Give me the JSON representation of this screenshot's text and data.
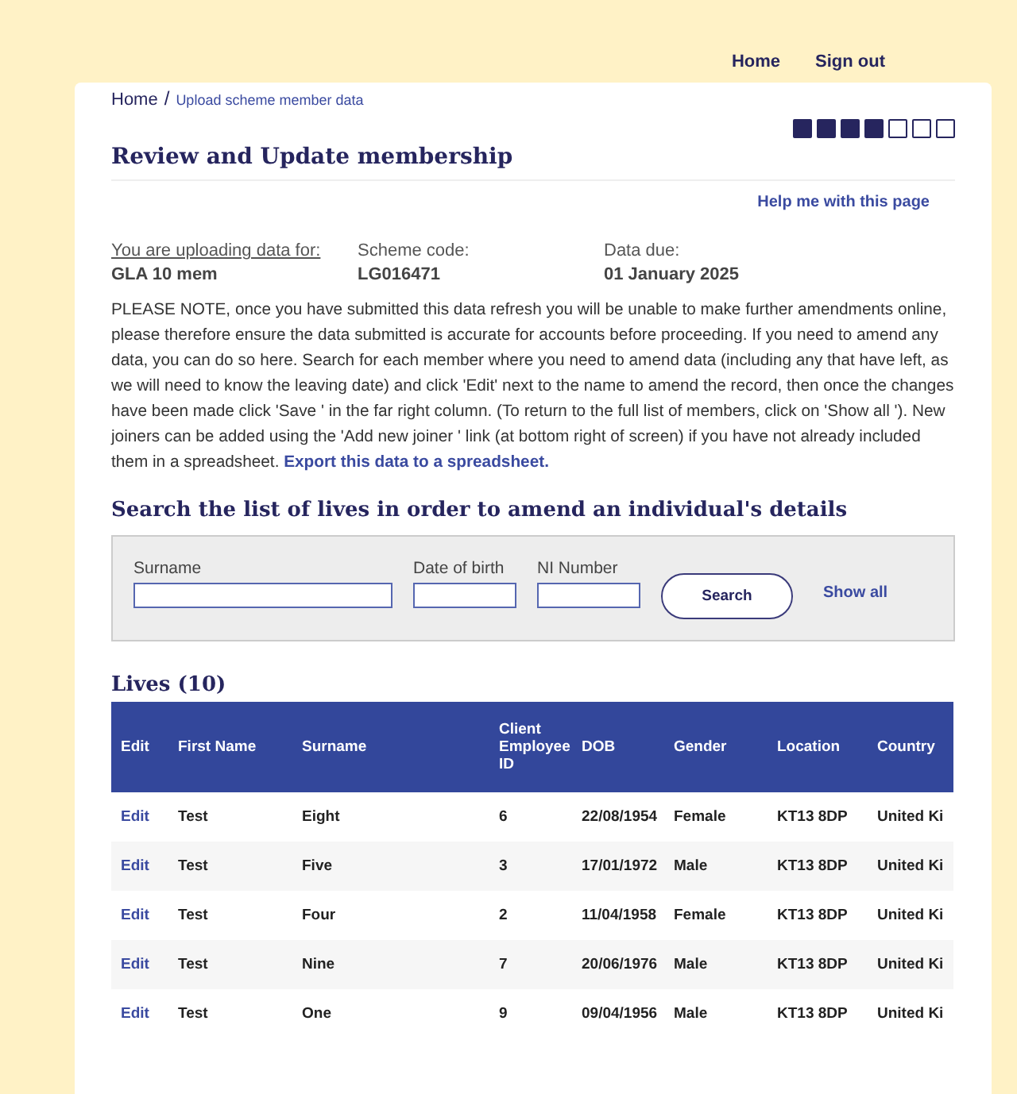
{
  "top_nav": [
    {
      "label": "Home"
    },
    {
      "label": "Sign out"
    }
  ],
  "breadcrumb": [
    {
      "label": "Home"
    },
    {
      "label": "Upload scheme member data"
    }
  ],
  "breadcrumb_separator": "/",
  "progress_steps": [
    {
      "done": true
    },
    {
      "done": true
    },
    {
      "done": true
    },
    {
      "done": true
    },
    {
      "done": false
    },
    {
      "done": false
    },
    {
      "done": false
    }
  ],
  "title": "Review and Update membership",
  "help_link": "Help me with this page",
  "summary": [
    {
      "label": "You are uploading data for:",
      "value": "GLA 10 mem",
      "underlined": true
    },
    {
      "label": "Scheme code:",
      "value": "LG016471",
      "underlined": false
    },
    {
      "label": "Data due:",
      "value": "01 January 2025",
      "underlined": false
    }
  ],
  "notice": "PLEASE NOTE, once you have submitted this data refresh you will be unable to make further amendments online, please therefore ensure the data submitted is accurate for accounts before proceeding. If you need to amend any data, you can do so here. Search for each member where you need to amend data (including any that have left, as we will need to know the leaving date) and click 'Edit' next to the name to amend the record, then once the changes have been made click 'Save ' in the far right column. (To return to the full list of members, click on 'Show all '). New joiners can be added using the 'Add new joiner ' link (at bottom right of screen) if you have not already included them in a spreadsheet.",
  "export_link": "Export this data to a spreadsheet.",
  "search": {
    "heading": "Search the list of lives in order to amend an individual's details",
    "fields": [
      {
        "label": "Surname"
      },
      {
        "label": "Date of birth"
      },
      {
        "label": "NI Number"
      }
    ],
    "button": "Search",
    "show_all": "Show all"
  },
  "table": {
    "heading": "Lives (10)",
    "columns": [
      "Edit",
      "First Name",
      "Surname",
      "Client Employee ID",
      "DOB",
      "Gender",
      "Location",
      "Country"
    ],
    "rows": [
      {
        "cells": [
          "Edit",
          "Test",
          "Eight",
          "6",
          "22/08/1954",
          "Female",
          "KT13 8DP",
          "United Ki"
        ]
      },
      {
        "cells": [
          "Edit",
          "Test",
          "Five",
          "3",
          "17/01/1972",
          "Male",
          "KT13 8DP",
          "United Ki"
        ]
      },
      {
        "cells": [
          "Edit",
          "Test",
          "Four",
          "2",
          "11/04/1958",
          "Female",
          "KT13 8DP",
          "United Ki"
        ]
      },
      {
        "cells": [
          "Edit",
          "Test",
          "Nine",
          "7",
          "20/06/1976",
          "Male",
          "KT13 8DP",
          "United Ki"
        ]
      },
      {
        "cells": [
          "Edit",
          "Test",
          "One",
          "9",
          "09/04/1956",
          "Male",
          "KT13 8DP",
          "United Ki"
        ]
      }
    ]
  }
}
